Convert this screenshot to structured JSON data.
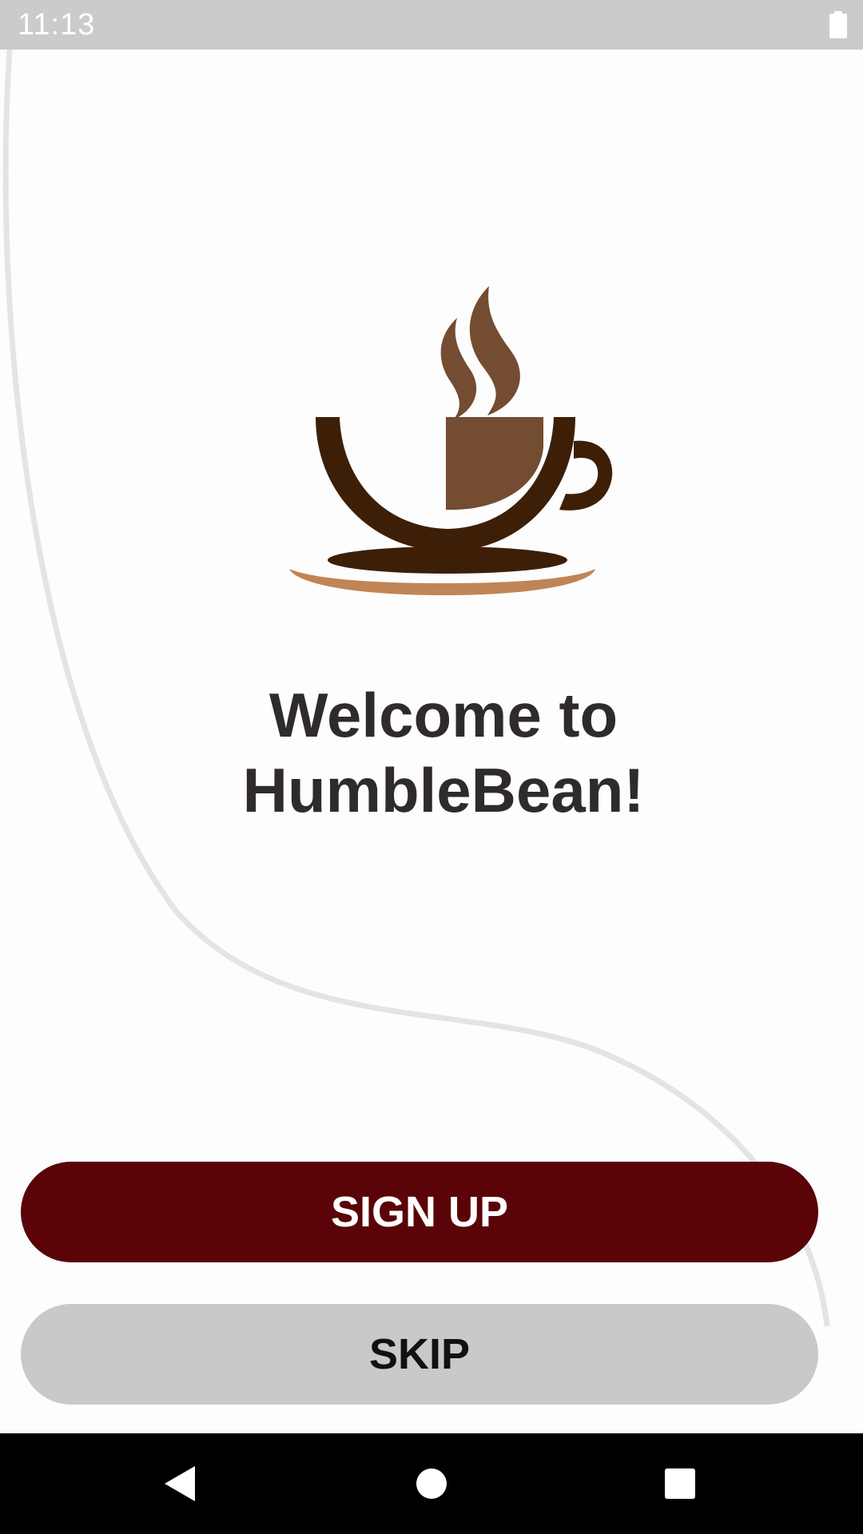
{
  "status_bar": {
    "time": "11:13",
    "battery_icon": "battery-full-icon"
  },
  "welcome": {
    "line1": "Welcome to",
    "line2": "HumbleBean!"
  },
  "buttons": {
    "signup_label": "SIGN UP",
    "skip_label": "SKIP"
  },
  "nav_bar": {
    "back_icon": "back-triangle-icon",
    "home_icon": "home-circle-icon",
    "recents_icon": "recents-square-icon"
  },
  "colors": {
    "primary": "#5a0407",
    "secondary_button": "#c9c9c9",
    "title_text": "#2f2b2b",
    "coffee_dark": "#3d1f08",
    "coffee_medium": "#744c32",
    "saucer_light": "#c08556",
    "status_bar": "#cbcbcb"
  }
}
